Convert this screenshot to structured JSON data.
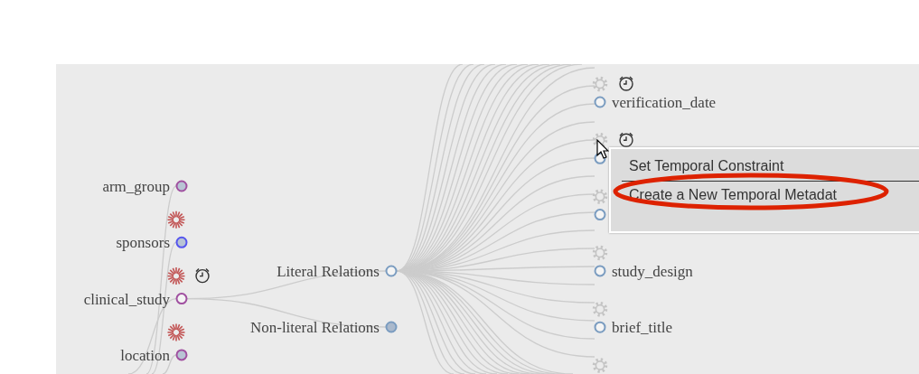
{
  "tree": {
    "left_nodes": [
      {
        "label": "arm_group",
        "color": "#a050a0",
        "filled": true,
        "starred": false,
        "timed": false
      },
      {
        "label": "sponsors",
        "color": "#5555ee",
        "filled": true,
        "starred": true,
        "timed": false
      },
      {
        "label": "clinical_study",
        "color": "#a050a0",
        "filled": false,
        "starred": true,
        "timed": true
      },
      {
        "label": "location",
        "color": "#a050a0",
        "filled": true,
        "starred": true,
        "timed": false
      }
    ],
    "relation_nodes": [
      {
        "label": "Literal Relations",
        "filled": false
      },
      {
        "label": "Non-literal Relations",
        "filled": true
      }
    ],
    "attribute_nodes": [
      {
        "label": "verification_date",
        "timed": true
      },
      {
        "timed": true
      },
      {
        "timed": false
      },
      {
        "label": "study_design",
        "timed": false
      },
      {
        "label": "brief_title",
        "timed": false
      },
      {
        "timed": false
      }
    ]
  },
  "context_menu": {
    "items": [
      {
        "label": "Set Temporal Constraint",
        "highlighted": false
      },
      {
        "label": "Create a New Temporal Metadat",
        "highlighted": true
      }
    ]
  }
}
